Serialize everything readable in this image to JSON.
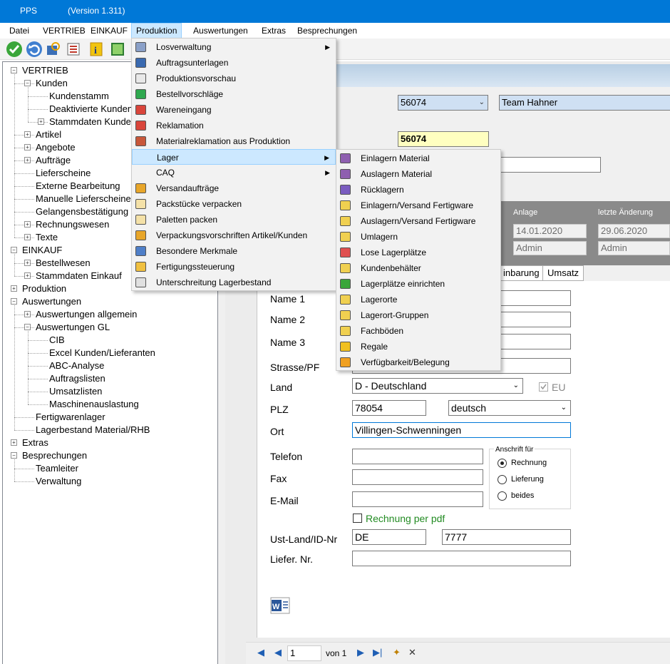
{
  "titlebar": {
    "app": "PPS",
    "version": "(Version 1.311)"
  },
  "menubar": [
    "Datei",
    "VERTRIEB",
    "EINKAUF",
    "Produktion",
    "Auswertungen",
    "Extras",
    "Besprechungen"
  ],
  "tree": [
    "VERTRIEB",
    "Kunden",
    "Kundenstamm",
    "Deaktivierte Kunden",
    "Stammdaten Kunden",
    "Artikel",
    "Angebote",
    "Aufträge",
    "Lieferscheine",
    "Externe Bearbeitung",
    "Manuelle Lieferscheine",
    "Gelangensbestätigung",
    "Rechnungswesen",
    "Texte",
    "EINKAUF",
    "Bestellwesen",
    "Stammdaten Einkauf",
    "Produktion",
    "Auswertungen",
    "Auswertungen allgemein",
    "Auswertungen GL",
    "CIB",
    "Excel Kunden/Lieferanten",
    "ABC-Analyse",
    "Auftragslisten",
    "Umsatzlisten",
    "Maschinenauslastung",
    "Fertigwarenlager",
    "Lagerbestand Material/RHB",
    "Extras",
    "Besprechungen",
    "Teamleiter",
    "Verwaltung"
  ],
  "produktion_menu": [
    "Losverwaltung",
    "Auftragsunterlagen",
    "Produktionsvorschau",
    "Bestellvorschläge",
    "Wareneingang",
    "Reklamation",
    "Materialreklamation aus Produktion",
    "Lager",
    "CAQ",
    "Versandaufträge",
    "Packstücke verpacken",
    "Paletten packen",
    "Verpackungsvorschriften Artikel/Kunden",
    "Besondere Merkmale",
    "Fertigungssteuerung",
    "Unterschreitung Lagerbestand"
  ],
  "lager_menu": [
    "Einlagern Material",
    "Auslagern Material",
    "Rücklagern",
    "Einlagern/Versand Fertigware",
    "Auslagern/Versand Fertigware",
    "Umlagern",
    "Lose Lagerplätze",
    "Kundenbehälter",
    "Lagerplätze einrichten",
    "Lagerorte",
    "Lagerort-Gruppen",
    "Fachböden",
    "Regale",
    "Verfügbarkeit/Belegung"
  ],
  "header": {
    "customer_combo": "56074",
    "customer_name": "Team Hahner",
    "customer_no": "56074",
    "anlage_label": "Anlage",
    "aenderung_label": "letzte Änderung",
    "anlage_date": "14.01.2020",
    "aenderung_date": "29.06.2020",
    "anlage_user": "Admin",
    "aenderung_user": "Admin"
  },
  "tabs": [
    "inbarung",
    "Umsatz"
  ],
  "form": {
    "name1_label": "Name 1",
    "name2_label": "Name 2",
    "name3_label": "Name 3",
    "strasse_label": "Strasse/PF",
    "land_label": "Land",
    "land_value": "D - Deutschland",
    "eu_label": "EU",
    "plz_label": "PLZ",
    "plz_value": "78054",
    "sprache_value": "deutsch",
    "ort_label": "Ort",
    "ort_value": "Villingen-Schwenningen",
    "telefon_label": "Telefon",
    "fax_label": "Fax",
    "email_label": "E-Mail",
    "anschrift_title": "Anschrift für",
    "anschrift_options": [
      "Rechnung",
      "Lieferung",
      "beides"
    ],
    "anschrift_selected": "Rechnung",
    "pdf_label": "Rechnung per pdf",
    "ust_label": "Ust-Land/ID-Nr",
    "ust_land": "DE",
    "ust_id": "7777",
    "liefer_label": "Liefer. Nr."
  },
  "navigator": {
    "position": "1",
    "of_label": "von 1"
  },
  "colors": {
    "accent": "#0078d7",
    "menu_highlight": "#cce8ff",
    "customer_no_bg": "#ffffc0",
    "green_label": "#228b22"
  }
}
